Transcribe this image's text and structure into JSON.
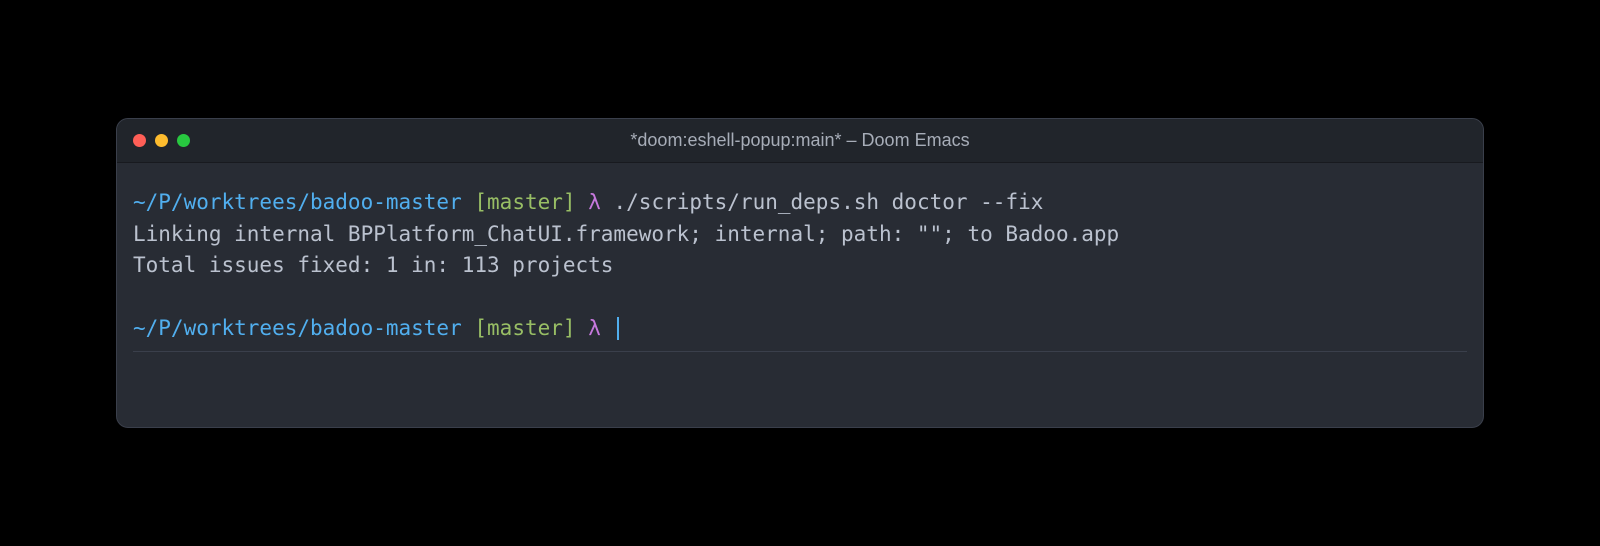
{
  "window": {
    "title": "*doom:eshell-popup:main* – Doom Emacs"
  },
  "terminal": {
    "prompt1": {
      "path": "~/P/worktrees/badoo-master",
      "branch": "[master]",
      "lambda": "λ",
      "command": "./scripts/run_deps.sh doctor --fix"
    },
    "output_line1": "Linking internal BPPlatform_ChatUI.framework; internal; path: \"\"; to Badoo.app",
    "output_line2": "Total issues fixed: 1 in: 113 projects",
    "prompt2": {
      "path": "~/P/worktrees/badoo-master",
      "branch": "[master]",
      "lambda": "λ"
    }
  },
  "colors": {
    "bg": "#282c34",
    "titlebar": "#21252b",
    "path": "#51afef",
    "branch": "#98be65",
    "lambda": "#c678dd",
    "text": "#bbc2cf",
    "cursor": "#51afef"
  }
}
